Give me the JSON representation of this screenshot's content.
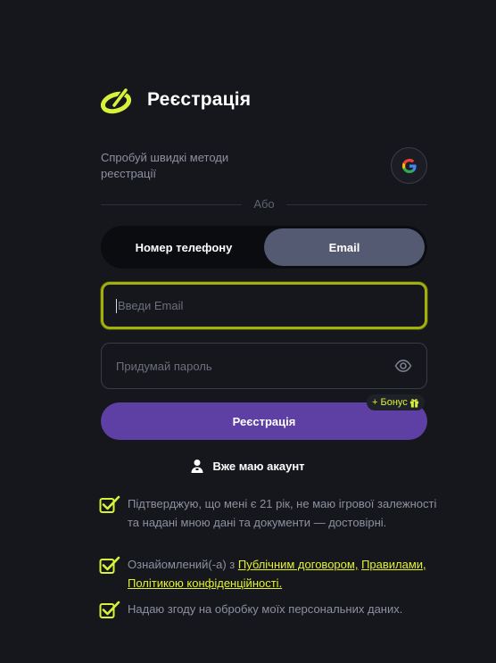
{
  "header": {
    "title": "Реєстрація",
    "logo_icon": "ball-logo-icon"
  },
  "quick": {
    "text": "Спробуй швидкі методи реєстрації",
    "google_icon": "google-icon"
  },
  "divider": {
    "text": "Або"
  },
  "toggle": {
    "phone_label": "Номер телефону",
    "email_label": "Email",
    "selected": "Email"
  },
  "email_field": {
    "placeholder": "Введи Email",
    "value": ""
  },
  "password_field": {
    "placeholder": "Придумай пароль",
    "value": "",
    "eye_icon": "eye-icon"
  },
  "bonus": {
    "label": "+ Бонус",
    "icon": "gift-icon"
  },
  "submit": {
    "label": "Реєстрація"
  },
  "account": {
    "label": "Вже маю акаунт",
    "icon": "user-icon"
  },
  "consents": {
    "age": {
      "checked": true,
      "text": "Підтверджую, що мені є 21 рік, не маю ігрової залежності та надані мною дані та документи — достовірні."
    },
    "terms": {
      "checked": true,
      "prefix": "Ознайомлений(-а) з ",
      "link_contract": "Публічним договором,",
      "link_rules": "Правилами,",
      "link_privacy": "Політикою конфіденційності."
    },
    "data": {
      "checked": true,
      "text": "Надаю згоду на обробку моїх персональних даних."
    }
  },
  "colors": {
    "background": "#16171d",
    "accent": "#d8f23a",
    "primary_button": "#5e3fa3",
    "toggle_active": "#545a72",
    "focus_border": "#a2b00f"
  }
}
